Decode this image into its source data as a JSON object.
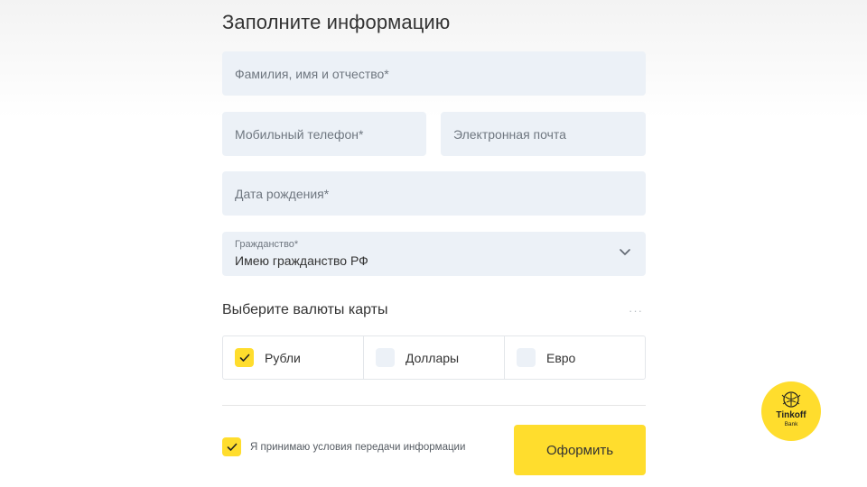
{
  "form": {
    "title": "Заполните информацию",
    "fields": {
      "full_name_placeholder": "Фамилия, имя и отчество*",
      "phone_placeholder": "Мобильный телефон*",
      "email_placeholder": "Электронная почта",
      "birthdate_placeholder": "Дата рождения*",
      "citizenship": {
        "label": "Гражданство*",
        "value": "Имею гражданство РФ"
      }
    },
    "currency": {
      "title": "Выберите валюты карты",
      "options": [
        {
          "label": "Рубли",
          "checked": true
        },
        {
          "label": "Доллары",
          "checked": false
        },
        {
          "label": "Евро",
          "checked": false
        }
      ]
    },
    "consent": {
      "label": "Я принимаю условия передачи информации",
      "checked": true
    },
    "submit_label": "Оформить"
  },
  "logo": {
    "name": "Tinkoff",
    "sub": "Bank"
  },
  "colors": {
    "accent": "#ffdd2d",
    "field_bg": "#ecf1f7",
    "text": "#333333",
    "placeholder": "#6f7780"
  }
}
